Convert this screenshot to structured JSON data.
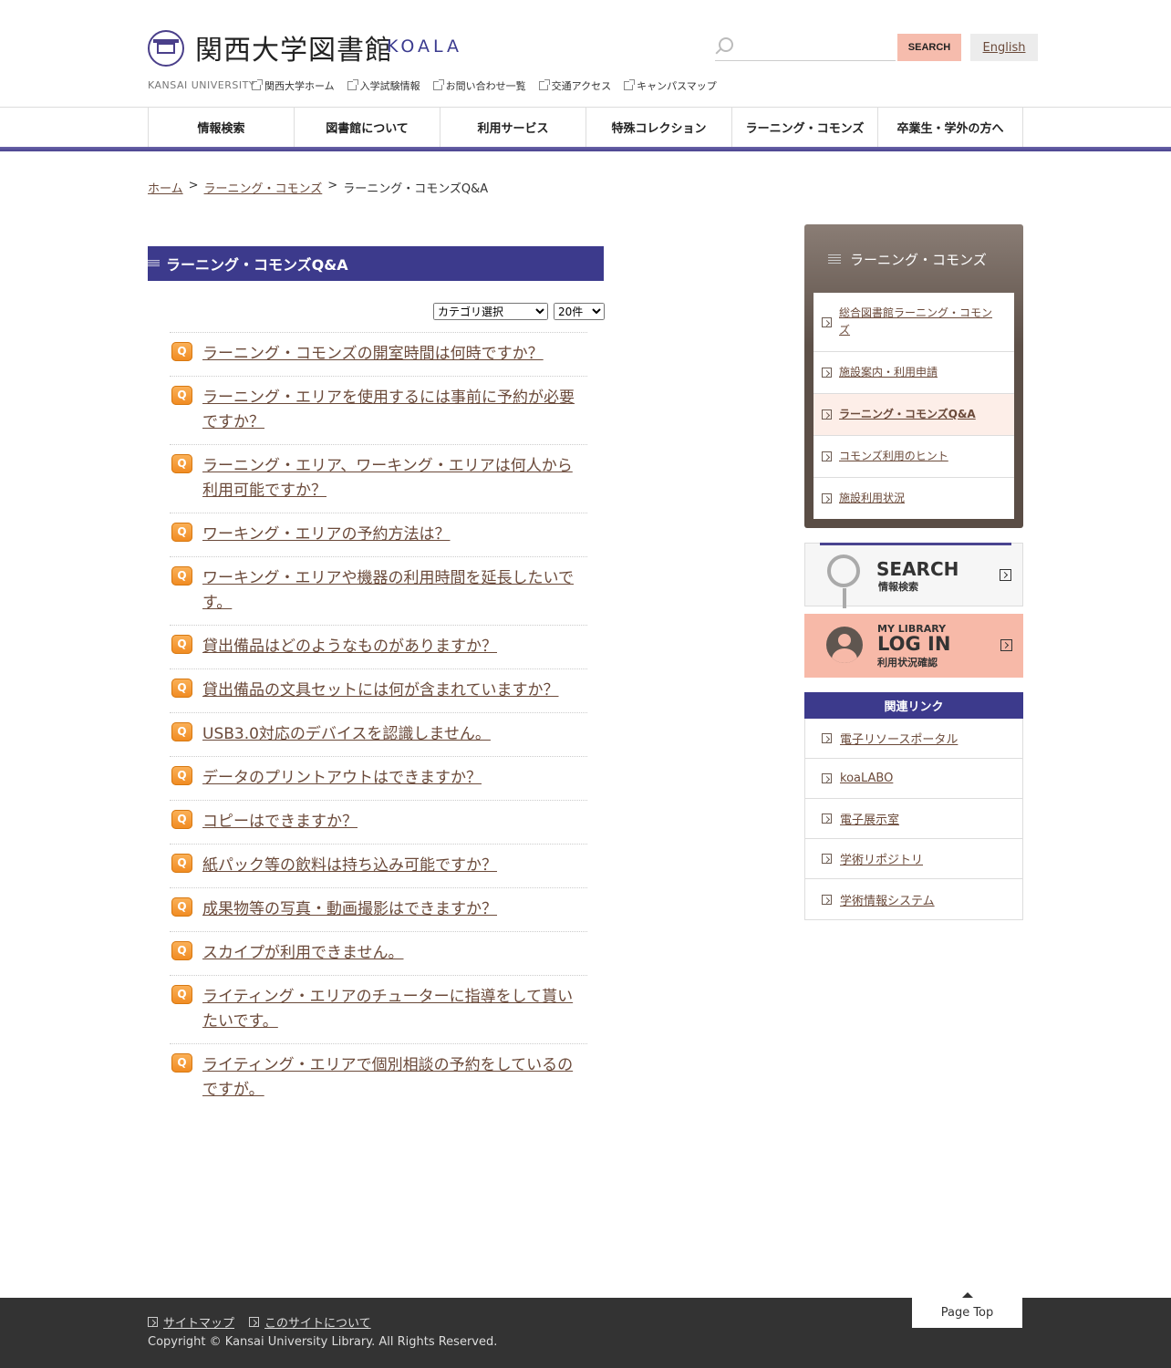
{
  "header": {
    "title": "関西大学図書館",
    "subtitle": "KOALA",
    "university": "KANSAI UNIVERSITY",
    "top_links": [
      "関西大学ホーム",
      "入学試験情報",
      "お問い合わせ一覧",
      "交通アクセス",
      "キャンパスマップ"
    ],
    "search": {
      "placeholder": "",
      "button": "SEARCH"
    },
    "english": "English"
  },
  "nav": [
    "情報検索",
    "図書館について",
    "利用サービス",
    "特殊コレクション",
    "ラーニング・コモンズ",
    "卒業生・学外の方へ"
  ],
  "breadcrumb": {
    "home": "ホーム",
    "sep": ">",
    "section": "ラーニング・コモンズ",
    "current": "ラーニング・コモンズQ&A"
  },
  "main": {
    "heading": "ラーニング・コモンズQ&A",
    "category_select": "カテゴリ選択",
    "count_select": "20件",
    "q_label": "Q",
    "questions": [
      "ラーニング・コモンズの開室時間は何時ですか？",
      "ラーニング・エリアを使用するには事前に予約が必要ですか？",
      "ラーニング・エリア、ワーキング・エリアは何人から利用可能ですか？",
      "ワーキング・エリアの予約方法は？",
      "ワーキング・エリアや機器の利用時間を延長したいです。",
      "貸出備品はどのようなものがありますか？",
      "貸出備品の文具セットには何が含まれていますか？",
      "USB3.0対応のデバイスを認識しません。",
      "データのプリントアウトはできますか？",
      "コピーはできますか？",
      "紙パック等の飲料は持ち込み可能ですか？",
      "成果物等の写真・動画撮影はできますか？",
      "スカイプが利用できません。",
      "ライティング・エリアのチューターに指導をして貰いたいです。",
      "ライティング・エリアで個別相談の予約をしているのですが。"
    ]
  },
  "sidebar": {
    "title": "ラーニング・コモンズ",
    "items": [
      "総合図書館ラーニング・コモンズ",
      "施設案内・利用申請",
      "ラーニング・コモンズQ&A",
      "コモンズ利用のヒント",
      "施設利用状況"
    ],
    "search_banner": {
      "big": "SEARCH",
      "small": "情報検索"
    },
    "login_banner": {
      "l1": "MY LIBRARY",
      "l2": "LOG IN",
      "l3": "利用状況確認"
    },
    "related_title": "関連リンク",
    "related": [
      "電子リソースポータル",
      "koaLABO",
      "電子展示室",
      "学術リポジトリ",
      "学術情報システム"
    ]
  },
  "footer": {
    "links": [
      "サイトマップ",
      "このサイトについて"
    ],
    "copyright": "Copyright © Kansai University Library. All Rights Reserved.",
    "pagetop": "Page Top"
  }
}
